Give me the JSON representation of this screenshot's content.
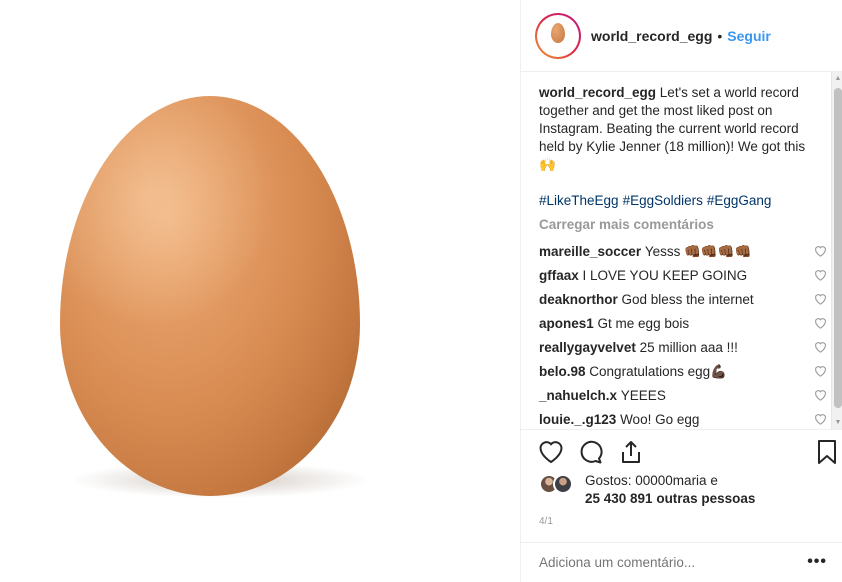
{
  "post": {
    "username": "world_record_egg",
    "follow_label": "Seguir",
    "dot": "•"
  },
  "caption": {
    "user": "world_record_egg",
    "text": "Let's set a world record together and get the most liked post on Instagram. Beating the current world record held by Kylie Jenner (18 million)! We got this 🙌"
  },
  "hashtags": [
    "#LikeTheEgg",
    "#EggSoldiers",
    "#EggGang"
  ],
  "load_more_label": "Carregar mais comentários",
  "comments": [
    {
      "user": "mareille_soccer",
      "text": "Yesss 👊🏾👊🏾👊🏾👊🏾"
    },
    {
      "user": "gffaax",
      "text": "I LOVE YOU KEEP GOING"
    },
    {
      "user": "deaknorthor",
      "text": "God bless the internet"
    },
    {
      "user": "apones1",
      "text": "Gt me egg bois"
    },
    {
      "user": "reallygayvelvet",
      "text": "25 million aaa !!!"
    },
    {
      "user": "belo.98",
      "text": "Congratulations egg💪🏿"
    },
    {
      "user": "_nahuelch.x",
      "text": "YEEES"
    },
    {
      "user": "louie._.g123",
      "text": "Woo! Go egg"
    }
  ],
  "likes": {
    "line1": "Gostos: 00000maria e",
    "line2": "25 430 891 outras pessoas"
  },
  "media_counter": "4/1",
  "add_comment_placeholder": "Adiciona um comentário...",
  "more_label": "•••",
  "icons": {
    "like": "heart-icon",
    "comment": "comment-icon",
    "share": "share-icon",
    "save": "bookmark-icon"
  }
}
